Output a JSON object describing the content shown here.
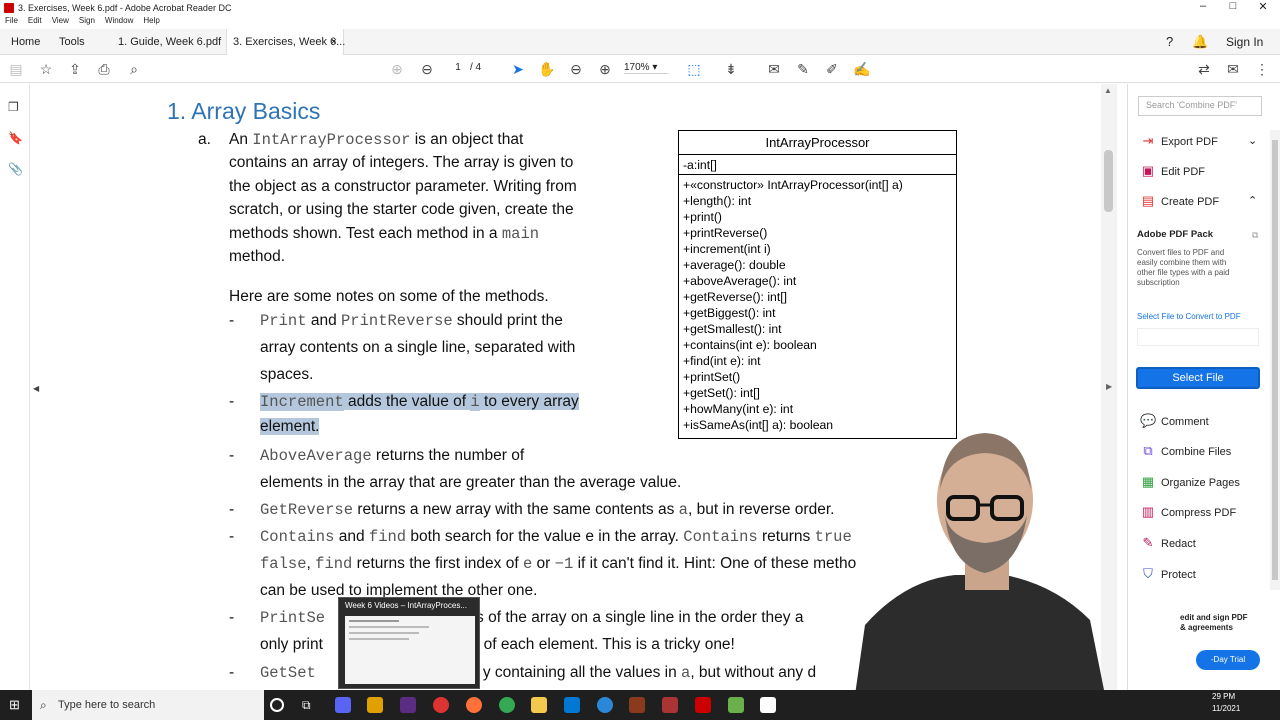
{
  "window": {
    "title": "3. Exercises, Week 6.pdf - Adobe Acrobat Reader DC"
  },
  "menu": [
    "File",
    "Edit",
    "View",
    "Sign",
    "Window",
    "Help"
  ],
  "tabs": {
    "home": "Home",
    "tools": "Tools",
    "doc1": "1. Guide, Week 6.pdf",
    "doc2": "3. Exercises, Week 6...",
    "close": "×",
    "sign_in": "Sign In"
  },
  "toolbar": {
    "page_current": "1",
    "page_total": "/ 4",
    "zoom": "170%"
  },
  "document": {
    "heading": "1. Array Basics",
    "item_a_label": "a.",
    "intro_lines": [
      {
        "pre": "An ",
        "code": "IntArrayProcessor",
        "post": " is an object that"
      },
      {
        "pre": "contains an array of integers. The array is given to",
        "code": "",
        "post": ""
      },
      {
        "pre": "the object as a constructor parameter. Writing from",
        "code": "",
        "post": ""
      },
      {
        "pre": "scratch, or using the starter code given, create the",
        "code": "",
        "post": ""
      },
      {
        "pre": "methods shown.  Test each method in a ",
        "code": "main",
        "post": ""
      },
      {
        "pre": "method.",
        "code": "",
        "post": ""
      }
    ],
    "notes_intro": "Here are some notes on some of the methods.",
    "bullet": "-",
    "notes": {
      "n1_code1": "Print",
      "n1_and": " and ",
      "n1_code2": "PrintReverse",
      "n1_post": " should print the",
      "n1_l2": "array contents on a single line, separated with",
      "n1_l3": "spaces.",
      "n2_code": "Increment",
      "n2_mid": " adds the value of ",
      "n2_i": "i",
      "n2_post": " to every array",
      "n2_l2": "element.",
      "n3_code": "AboveAverage",
      "n3_post": " returns the number of",
      "n3_l2": "elements in the array that are greater than the average value.",
      "n4_code": "GetReverse",
      "n4_post": " returns a new array with the same contents as ",
      "n4_a": "a",
      "n4_end": ", but in reverse order.",
      "n5_code1": "Contains",
      "n5_and": " and ",
      "n5_code2": "find",
      "n5_post": " both search for the value e in the array. ",
      "n5_code3": "Contains",
      "n5_ret": " returns ",
      "n5_true": "true",
      "n5_false": "false",
      "n5_comma": ", ",
      "n5_find": "find",
      "n5_l2": " returns the first index of ",
      "n5_e": "e",
      "n5_or": " or ",
      "n5_m1": "−1",
      "n5_l2b": " if it can't find it. Hint: One of these metho",
      "n5_l3": "can be used to implement the other one.",
      "n6_code": "PrintSe",
      "n6_post": "nts of the array on a single line in the order they a",
      "n6_l2a": "only print",
      "n6_l2b": "ce of each element. This is a tricky one!",
      "n7_code": "GetSet",
      "n7_post": "y containing all the values in ",
      "n7_a": "a",
      "n7_end": ", but without any d"
    },
    "uml": {
      "title": "IntArrayProcessor",
      "attribute": "-a:int[]",
      "methods": [
        "+«constructor» IntArrayProcessor(int[] a)",
        "+length(): int",
        "+print()",
        "+printReverse()",
        "+increment(int i)",
        "+average(): double",
        "+aboveAverage(): int",
        "+getReverse(): int[]",
        "+getBiggest(): int",
        "+getSmallest(): int",
        "+contains(int e): boolean",
        "+find(int e): int",
        "+printSet()",
        "+getSet(): int[]",
        "+howMany(int e): int",
        "+isSameAs(int[] a): boolean"
      ]
    }
  },
  "right_pane": {
    "search_placeholder": "Search 'Combine PDF'",
    "export": "Export PDF",
    "edit": "Edit PDF",
    "create": "Create PDF",
    "pack_title": "Adobe PDF Pack",
    "pack_desc": [
      "Convert files to PDF and",
      "easily combine them with",
      "other file types with a paid",
      "subscription"
    ],
    "select_link": "Select File to Convert to PDF",
    "select_button": "Select File",
    "tools": [
      "Comment",
      "Combine Files",
      "Organize Pages",
      "Compress PDF",
      "Redact",
      "Protect"
    ],
    "promo_1": "edit and sign PDF",
    "promo_2": "& agreements",
    "trial": "-Day Trial"
  },
  "thumbnail_preview": {
    "title": "Week 6 Videos – IntArrayProces..."
  },
  "taskbar": {
    "search_placeholder": "Type here to search",
    "time": "29 PM",
    "date": "11/2021"
  },
  "colors": {
    "heading": "#2e74b5",
    "highlight": "#b4c7dc",
    "accent": "#1473e6",
    "taskbar": "#1f1f1f"
  },
  "icons": [
    "bookmark-icon",
    "star-icon",
    "upload-icon",
    "print-icon",
    "search-icon",
    "page-up-icon",
    "page-down-icon",
    "select-arrow-icon",
    "hand-icon",
    "zoom-out-icon",
    "zoom-in-icon",
    "help-icon",
    "bell-icon",
    "share-icon",
    "mail-icon",
    "more-icon"
  ]
}
